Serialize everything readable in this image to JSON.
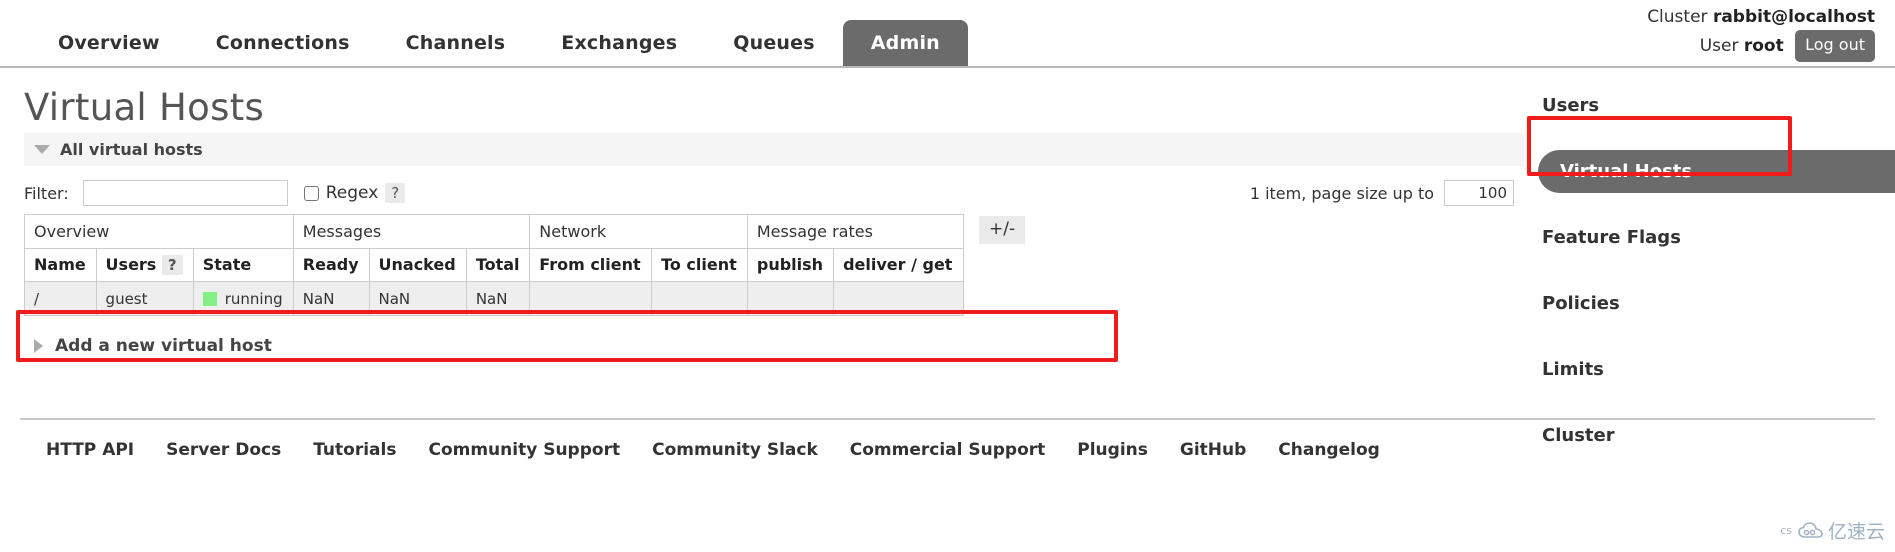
{
  "topnav": {
    "items": [
      {
        "label": "Overview",
        "active": false
      },
      {
        "label": "Connections",
        "active": false
      },
      {
        "label": "Channels",
        "active": false
      },
      {
        "label": "Exchanges",
        "active": false
      },
      {
        "label": "Queues",
        "active": false
      },
      {
        "label": "Admin",
        "active": true
      }
    ]
  },
  "header": {
    "cluster_prefix": "Cluster",
    "cluster_name": "rabbit@localhost",
    "user_prefix": "User",
    "user_name": "root",
    "logout_label": "Log out"
  },
  "page": {
    "title": "Virtual Hosts",
    "section_label": "All virtual hosts",
    "add_new_label": "Add a new virtual host"
  },
  "filter": {
    "label": "Filter:",
    "value": "",
    "placeholder": "",
    "regex_label": "Regex",
    "regex_checked": false,
    "help_badge": "?"
  },
  "paging": {
    "summary": "1 item, page size up to",
    "page_size": "100"
  },
  "table": {
    "column_toggle_label": "+/-",
    "group_headers": [
      {
        "label": "Overview",
        "span": 3
      },
      {
        "label": "Messages",
        "span": 3
      },
      {
        "label": "Network",
        "span": 2
      },
      {
        "label": "Message rates",
        "span": 2
      }
    ],
    "columns": [
      {
        "label": "Name",
        "align": "left"
      },
      {
        "label": "Users",
        "align": "left",
        "badge": "?"
      },
      {
        "label": "State",
        "align": "left"
      },
      {
        "label": "Ready",
        "align": "right"
      },
      {
        "label": "Unacked",
        "align": "right"
      },
      {
        "label": "Total",
        "align": "right"
      },
      {
        "label": "From client",
        "align": "right"
      },
      {
        "label": "To client",
        "align": "right"
      },
      {
        "label": "publish",
        "align": "right"
      },
      {
        "label": "deliver / get",
        "align": "right"
      }
    ],
    "rows": [
      {
        "name": "/",
        "users": "guest",
        "state": "running",
        "state_color": "#84ef84",
        "ready": "NaN",
        "unacked": "NaN",
        "total": "NaN",
        "from_client": "",
        "to_client": "",
        "publish": "",
        "deliver_get": ""
      }
    ]
  },
  "sidebar": {
    "items": [
      {
        "label": "Users",
        "active": false
      },
      {
        "label": "Virtual Hosts",
        "active": true
      },
      {
        "label": "Feature Flags",
        "active": false
      },
      {
        "label": "Policies",
        "active": false
      },
      {
        "label": "Limits",
        "active": false
      },
      {
        "label": "Cluster",
        "active": false
      }
    ]
  },
  "footer": {
    "links": [
      "HTTP API",
      "Server Docs",
      "Tutorials",
      "Community Support",
      "Community Slack",
      "Commercial Support",
      "Plugins",
      "GitHub",
      "Changelog"
    ]
  },
  "watermark": {
    "small_text": "cs",
    "brand_text": "亿速云"
  },
  "annotations": {
    "accent_color": "#f01c1c"
  }
}
